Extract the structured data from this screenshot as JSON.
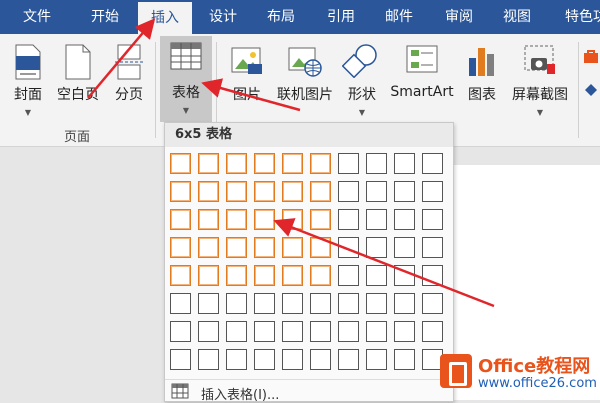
{
  "tabs": [
    {
      "label": "文件"
    },
    {
      "label": "开始"
    },
    {
      "label": "插入"
    },
    {
      "label": "设计"
    },
    {
      "label": "布局"
    },
    {
      "label": "引用"
    },
    {
      "label": "邮件"
    },
    {
      "label": "审阅"
    },
    {
      "label": "视图"
    },
    {
      "label": "特色功"
    }
  ],
  "active_tab": "插入",
  "ribbon": {
    "pages_group": {
      "label": "页面",
      "buttons": [
        {
          "label": "封面",
          "icon": "cover-page-icon",
          "has_dropdown": true
        },
        {
          "label": "空白页",
          "icon": "blank-page-icon",
          "has_dropdown": false
        },
        {
          "label": "分页",
          "icon": "page-break-icon",
          "has_dropdown": false
        }
      ]
    },
    "table_button": {
      "label": "表格",
      "icon": "table-icon",
      "has_dropdown": true
    },
    "illustrations": [
      {
        "label": "图片",
        "icon": "picture-icon"
      },
      {
        "label": "联机图片",
        "icon": "online-picture-icon"
      },
      {
        "label": "形状",
        "icon": "shapes-icon",
        "has_dropdown": true
      },
      {
        "label": "SmartArt",
        "icon": "smartart-icon"
      },
      {
        "label": "图表",
        "icon": "chart-icon"
      },
      {
        "label": "屏幕截图",
        "icon": "screenshot-icon",
        "has_dropdown": true
      }
    ]
  },
  "table_dropdown": {
    "title": "6x5 表格",
    "grid_cols": 10,
    "grid_rows": 8,
    "selected_cols": 6,
    "selected_rows": 5,
    "insert_table_label": "插入表格(I)..."
  },
  "watermark": {
    "title": "Office教程网",
    "url": "www.office26.com"
  },
  "colors": {
    "tab_bar": "#2b579a",
    "selection": "#e07b20",
    "arrow": "#e0262b"
  }
}
